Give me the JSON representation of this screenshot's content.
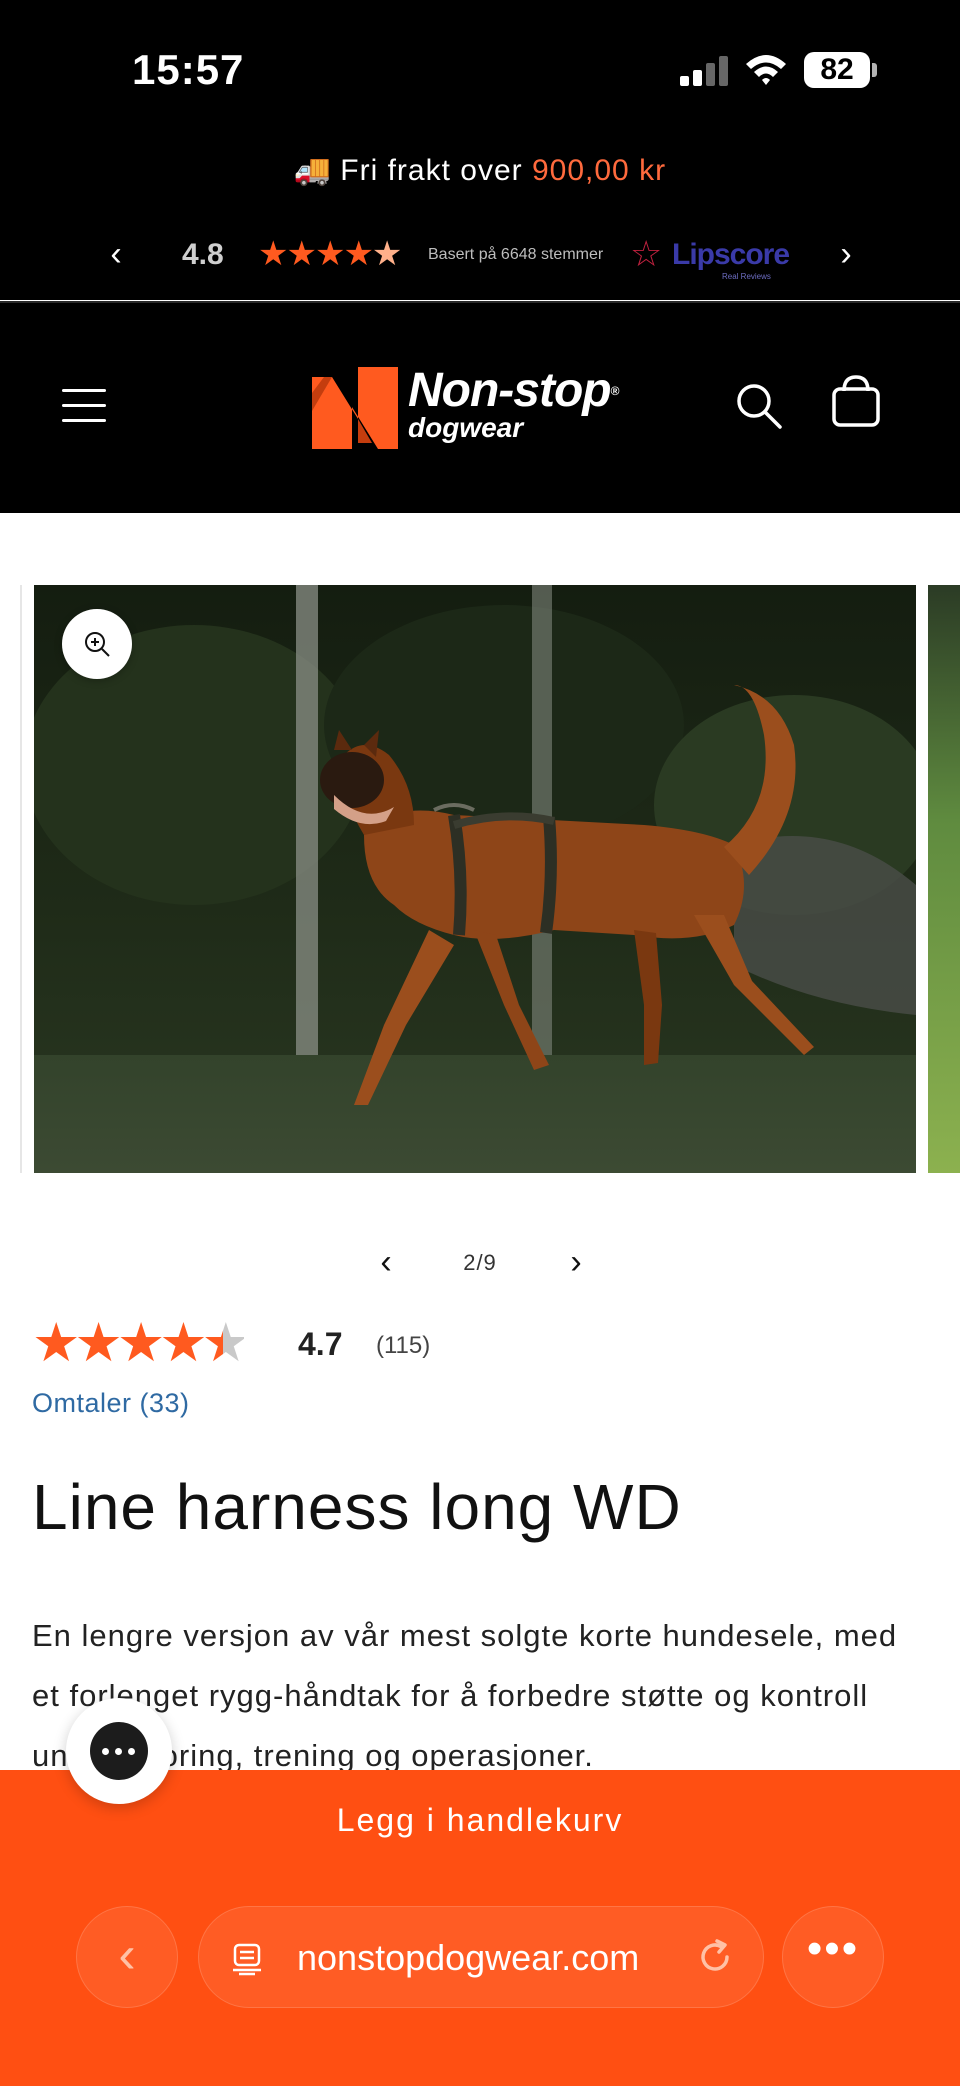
{
  "status_bar": {
    "time": "15:57",
    "battery": "82",
    "signal_icon": "cellular-signal-icon",
    "wifi_icon": "wifi-icon"
  },
  "promo": {
    "shipping_text": "Fri frakt over ",
    "shipping_price": "900,00 kr",
    "truck_icon": "🚚",
    "rating_score": "4.8",
    "rating_stars": "★★★★",
    "rating_star_partial": "★",
    "votes_text": "Basert på 6648 stemmer",
    "lipscore_name": "Lipscore",
    "lipscore_sub": "Real Reviews",
    "prev_arrow": "‹",
    "next_arrow": "›"
  },
  "header": {
    "brand_name": "Non-stop",
    "brand_reg": "®",
    "brand_sub": "dogwear",
    "colors": {
      "brand_orange": "#ff5a1f",
      "background": "#000000"
    }
  },
  "gallery": {
    "current": 2,
    "total": 9,
    "counter": "2/9",
    "prev_arrow": "‹",
    "next_arrow": "›"
  },
  "product": {
    "rating_stars_full": "★★★★",
    "rating_star_half": "★",
    "rating_value": 4.7,
    "rating_score": "4.7",
    "rating_count": "(115)",
    "reviews_link": "Omtaler (33)",
    "title": "Line harness long WD",
    "description": "En lengre versjon av vår mest solgte korte hundesele, med et forlenget rygg-håndtak for å forbedre støtte og kontroll under sporing, trening og operasjoner."
  },
  "bottom_bar": {
    "add_to_cart": "Legg i handlekurv",
    "back_arrow": "‹",
    "url": "nonstopdogwear.com",
    "more": "•••",
    "accent": "#ff4f12"
  }
}
